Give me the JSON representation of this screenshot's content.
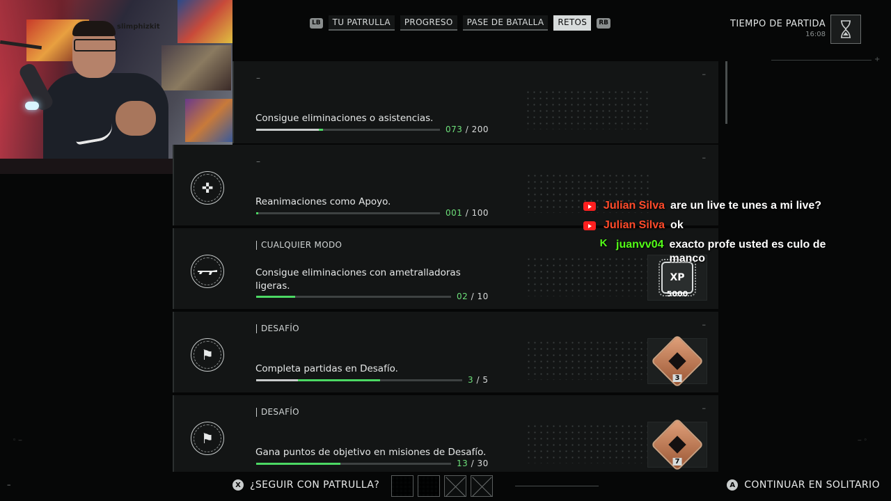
{
  "nav": {
    "lb": "LB",
    "rb": "RB",
    "tabs": [
      "TU PATRULLA",
      "PROGRESO",
      "PASE DE BATALLA",
      "RETOS"
    ],
    "active_tab": "RETOS"
  },
  "match": {
    "label": "TIEMPO DE PARTIDA",
    "time": "16:08"
  },
  "webcam": {
    "overlay_text": "slimphizkit"
  },
  "challenges": [
    {
      "mode": "–",
      "corner": "–",
      "description": "Consigue eliminaciones o asistencias.",
      "current": "073",
      "total": "200",
      "progress": 0.365,
      "emblem_icon": ""
    },
    {
      "mode": "–",
      "corner": "–",
      "description": "Reanimaciones como Apoyo.",
      "current": "001",
      "total": "100",
      "progress": 0.01,
      "emblem_icon": "revive-icon"
    },
    {
      "mode": "CUALQUIER MODO",
      "corner": "",
      "description": "Consigue eliminaciones con ametralladoras ligeras.",
      "current": "02",
      "total": "10",
      "progress": 0.2,
      "emblem_icon": "machine-gun-icon",
      "reward": {
        "type": "xp",
        "label": "XP",
        "amount": "5000"
      }
    },
    {
      "mode": "DESAFÍO",
      "corner": "–",
      "description": "Completa partidas en Desafío.",
      "current": "3",
      "total": "5",
      "progress": 0.6,
      "emblem_icon": "flag-icon",
      "reward": {
        "type": "badge",
        "amount": "3"
      }
    },
    {
      "mode": "DESAFÍO",
      "corner": "–",
      "description": "Gana puntos de objetivo en misiones de Desafío.",
      "current": "13",
      "total": "30",
      "progress": 0.433,
      "emblem_icon": "flag-icon",
      "reward": {
        "type": "badge",
        "amount": "7"
      }
    }
  ],
  "chat": [
    {
      "platform": "youtube",
      "user": "Julian Silva",
      "message": "are un live te unes a mi live?"
    },
    {
      "platform": "youtube",
      "user": "Julian Silva",
      "message": "ok"
    },
    {
      "platform": "kick",
      "user": "juanvv04",
      "message": "exacto profe usted es culo de manco"
    }
  ],
  "bottom": {
    "squad_glyph": "X",
    "squad_prompt": "¿SEGUIR CON PATRULLA?",
    "solo_glyph": "A",
    "solo_prompt": "CONTINUAR EN SOLITARIO",
    "left_mark": "–"
  },
  "colors": {
    "accent_green": "#4cd964",
    "youtube_red": "#ff4a2a",
    "kick_green": "#53fc18"
  }
}
